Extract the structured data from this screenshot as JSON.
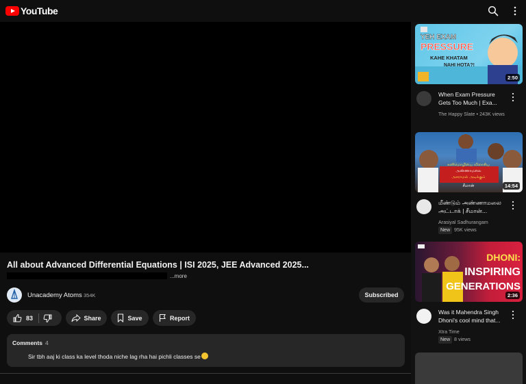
{
  "header": {
    "logo_text": "YouTube",
    "icons": [
      "search-icon",
      "more-vertical-icon"
    ]
  },
  "video": {
    "title": "All about Advanced Differential Equations | ISI 2025, JEE Advanced 2025...",
    "more_label": "...more",
    "channel_name": "Unacademy Atoms",
    "channel_subscribers": "354K",
    "subscribe_label": "Subscribed",
    "like_count": "83",
    "share_label": "Share",
    "save_label": "Save",
    "report_label": "Report"
  },
  "comments": {
    "label": "Comments",
    "count": "4",
    "top_comment": "Sir tbh aaj ki class ka level thoda niche lag rha hai pichli classes se"
  },
  "recommendations": [
    {
      "thumbnail_text": [
        "YEH EXAM",
        "PRESSURE",
        "KAHE KHATAM",
        "NAHI HOTA?!"
      ],
      "duration": "2:50",
      "title": "When Exam Pressure Gets Too Much | Exa...",
      "channel": "The Happy Slate",
      "meta": "243K views",
      "badge": ""
    },
    {
      "thumbnail_text": [
        "கனிமொழியை விளாசிய",
        "அண்ணாமலை",
        "அசராமல் அடிக்கும்",
        "சீமான்"
      ],
      "duration": "14:54",
      "title": "மீண்டும் அண்ணாமலை அட்டாக் | சீமான்...",
      "channel": "Arasiyal Sadhurangam",
      "meta": "95K views",
      "badge": "New"
    },
    {
      "thumbnail_text": [
        "DHONI:",
        "INSPIRING",
        "GENERATIONS"
      ],
      "duration": "2:36",
      "title": "Was it Mahendra Singh Dhoni's cool mind that...",
      "channel": "Xtra Time",
      "meta": "8 views",
      "badge": "New"
    }
  ]
}
